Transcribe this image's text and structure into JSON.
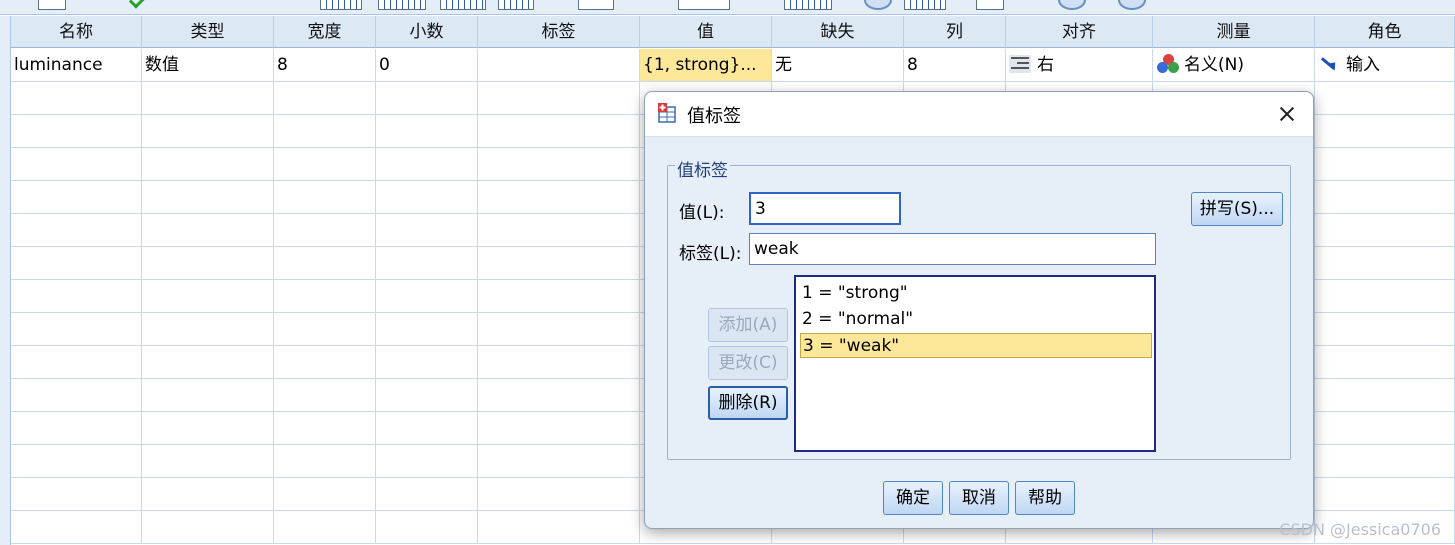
{
  "grid": {
    "columns": [
      "名称",
      "类型",
      "宽度",
      "小数",
      "标签",
      "值",
      "缺失",
      "列",
      "对齐",
      "测量",
      "角色"
    ],
    "row1": {
      "name": "luminance",
      "type": "数值",
      "width": "8",
      "decimals": "0",
      "label": "",
      "values": "{1, strong}...",
      "missing": "无",
      "columns": "8",
      "align": "右",
      "measure": "名义(N)",
      "role": "输入"
    }
  },
  "dialog": {
    "title": "值标签",
    "group_title": "值标签",
    "value_label": "值(L):",
    "value": "3",
    "label_label": "标签(L):",
    "label_value": "weak",
    "spell_button": "拼写(S)...",
    "add_button": "添加(A)",
    "change_button": "更改(C)",
    "delete_button": "删除(R)",
    "list": [
      "1 = \"strong\"",
      "2 = \"normal\"",
      "3 = \"weak\""
    ],
    "ok_button": "确定",
    "cancel_button": "取消",
    "help_button": "帮助"
  },
  "watermark": "CSDN @Jessica0706",
  "colors": {
    "header_bg": "#dde8f5",
    "selection": "#fde89a",
    "dialog_bg": "#e6eef8",
    "button_border": "#4f86c8"
  }
}
